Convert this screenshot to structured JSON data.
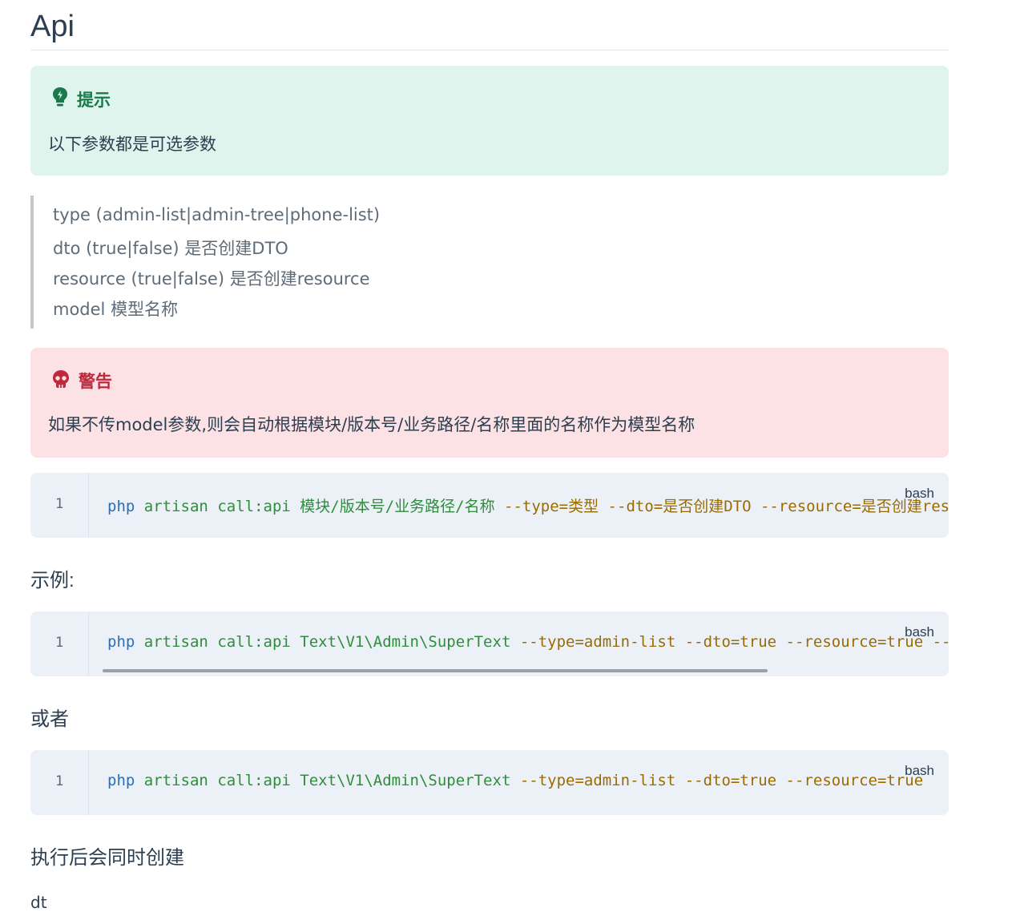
{
  "page": {
    "title": "Api",
    "tip": {
      "heading": "提示",
      "text": "以下参数都是可选参数",
      "icon": "lightbulb-icon",
      "accent": "#1a7a4a"
    },
    "quote_lines": [
      "type (admin-list|admin-tree|phone-list)",
      "dto (true|false) 是否创建DTO",
      "resource (true|false) 是否创建resource",
      "model 模型名称"
    ],
    "warning": {
      "heading": "警告",
      "text": "如果不传model参数,则会自动根据模块/版本号/业务路径/名称里面的名称作为模型名称",
      "icon": "skull-icon",
      "accent": "#c0283c"
    },
    "code_blocks": [
      {
        "lang": "bash",
        "line_number": "1",
        "tokens": {
          "cmd": "php",
          "word1": "artisan",
          "word2": "call:api",
          "arg": "模块/版本号/业务路径/名称",
          "rest": " --type=类型 --dto=是否创建DTO --resource=是否创建resource"
        }
      },
      {
        "lang": "bash",
        "line_number": "1",
        "tokens": {
          "cmd": "php",
          "word1": "artisan",
          "word2": "call:api",
          "arg": "Text\\V1\\Admin\\SuperText",
          "rest": " --type=admin-list --dto=true --resource=true --model=SuperText"
        }
      },
      {
        "lang": "bash",
        "line_number": "1",
        "tokens": {
          "cmd": "php",
          "word1": "artisan",
          "word2": "call:api",
          "arg": "Text\\V1\\Admin\\SuperText",
          "rest": " --type=admin-list --dto=true --resource=true"
        }
      }
    ],
    "example_label": "示例:",
    "or_label": "或者",
    "after_label": "执行后会同时创建",
    "cut_text": "dt"
  }
}
